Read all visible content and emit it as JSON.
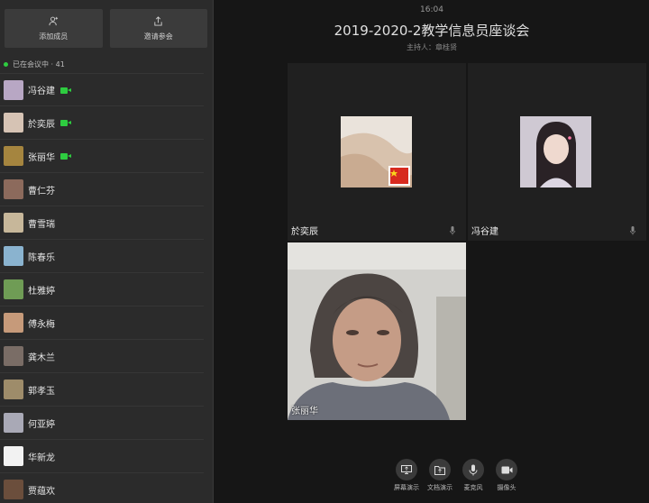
{
  "sidebar": {
    "add_member_label": "添加成员",
    "invite_label": "邀请参会",
    "in_meeting_text": "已在会议中 · 41",
    "members": [
      {
        "name": "冯谷建",
        "camera": true,
        "color": "#b8a7c4"
      },
      {
        "name": "於奕辰",
        "camera": true,
        "color": "#d6c3b4"
      },
      {
        "name": "张丽华",
        "camera": true,
        "color": "#a5853f"
      },
      {
        "name": "曹仁芬",
        "camera": false,
        "color": "#8c6a5c"
      },
      {
        "name": "曹雪瑞",
        "camera": false,
        "color": "#c7b79a"
      },
      {
        "name": "陈春乐",
        "camera": false,
        "color": "#8ab3cf"
      },
      {
        "name": "杜雅婷",
        "camera": false,
        "color": "#6f9c55"
      },
      {
        "name": "傅永梅",
        "camera": false,
        "color": "#c69a7a"
      },
      {
        "name": "龚木兰",
        "camera": false,
        "color": "#7a6d66"
      },
      {
        "name": "郭孝玉",
        "camera": false,
        "color": "#9e8c6a"
      },
      {
        "name": "何亚婷",
        "camera": false,
        "color": "#a9a9b6"
      },
      {
        "name": "华新龙",
        "camera": false,
        "color": "#f2f2f2"
      },
      {
        "name": "贾蕴欢",
        "camera": false,
        "color": "#6b4e3c"
      }
    ]
  },
  "meeting": {
    "time": "16:04",
    "title": "2019-2020-2教学信息员座谈会",
    "host": "主持人：章桂贤",
    "tiles": [
      {
        "name": "於奕辰"
      },
      {
        "name": "冯谷建"
      },
      {
        "name": "张丽华"
      }
    ]
  },
  "toolbar": {
    "items": [
      {
        "label": "屏幕演示",
        "icon": "screen-share-icon"
      },
      {
        "label": "文档演示",
        "icon": "document-icon"
      },
      {
        "label": "麦克风",
        "icon": "microphone-icon"
      },
      {
        "label": "摄像头",
        "icon": "camera-icon"
      }
    ]
  }
}
